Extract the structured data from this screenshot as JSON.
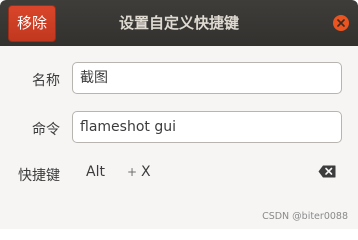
{
  "header": {
    "remove_label": "移除",
    "title": "设置自定义快捷键"
  },
  "form": {
    "name_label": "名称",
    "name_value": "截图",
    "command_label": "命令",
    "command_value": "flameshot gui",
    "shortcut_label": "快捷键",
    "shortcut_modifier": "Alt",
    "shortcut_plus": "+",
    "shortcut_key": "X"
  },
  "watermark": "CSDN @biter0088",
  "icons": {
    "close": "close-icon",
    "clear_shortcut": "backspace-icon"
  },
  "colors": {
    "remove_button": "#c7391f",
    "titlebar": "#383633",
    "close_button": "#e95420"
  }
}
